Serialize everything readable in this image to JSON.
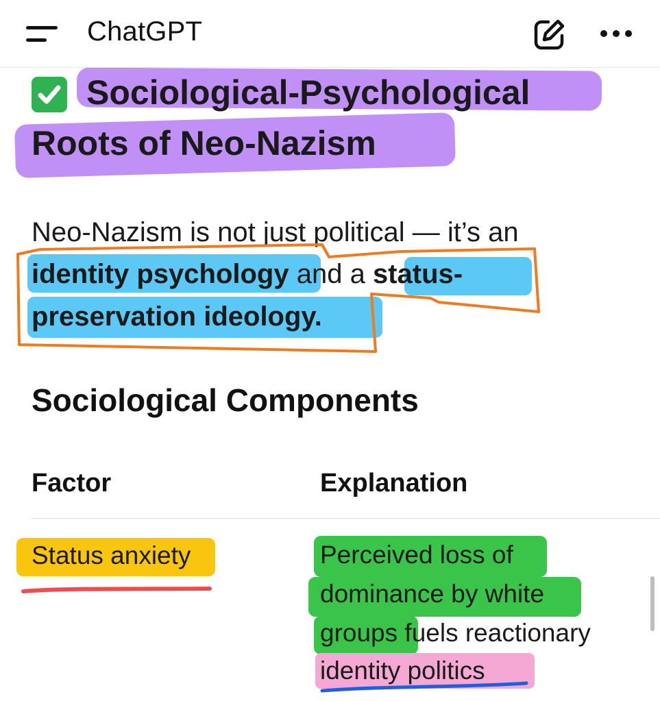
{
  "header": {
    "app_title": "ChatGPT",
    "icons": [
      "menu-icon",
      "compose-icon",
      "more-icon"
    ]
  },
  "section": {
    "check_emoji": "✅",
    "title_line1": "Sociological-Psychological",
    "title_line2": "Roots of Neo-Nazism",
    "intro": {
      "line1": "Neo-Nazism is not just political — it’s an",
      "line2_highlight_a": "identity psychology",
      "line2_mid": " and a ",
      "line2_highlight_b": "status-",
      "line3_highlight": "preservation ideology."
    },
    "subheading": "Sociological Components",
    "table": {
      "headers": [
        "Factor",
        "Explanation"
      ],
      "rows": [
        {
          "factor": "Status anxiety",
          "explanation_lines": [
            "Perceived loss of",
            "dominance by white",
            "groups",
            " fuels reactionary",
            "identity politics"
          ]
        }
      ]
    }
  },
  "colors": {
    "purple_highlight": "#b57cf5",
    "blue_highlight": "#5cc8f5",
    "orange_ink": "#f07a1e",
    "yellow_highlight": "#f9c50f",
    "green_highlight": "#3bc44a",
    "pink_highlight": "#f5a8d4",
    "red_ink": "#ef4d4d",
    "blue_ink": "#1e5fe0"
  }
}
